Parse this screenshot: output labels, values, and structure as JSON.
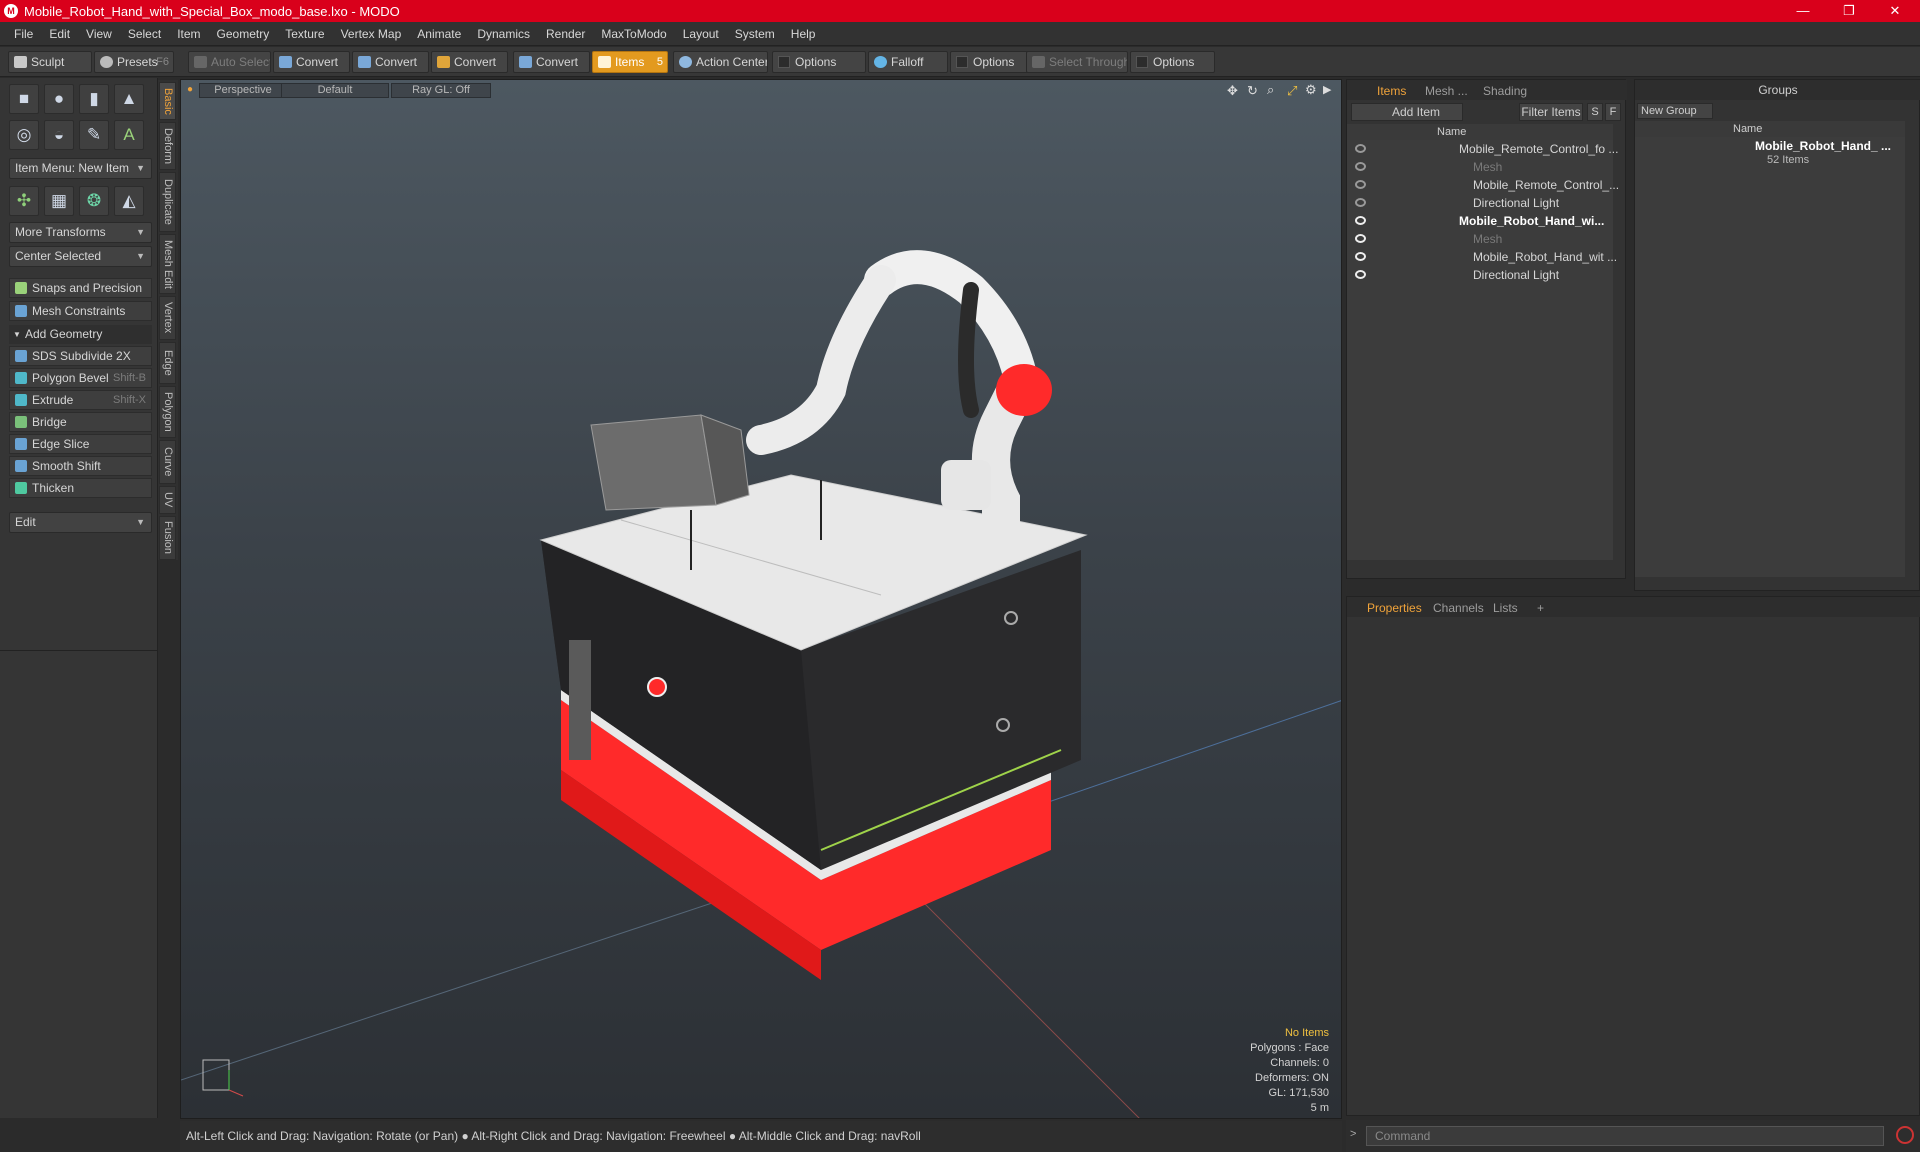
{
  "window": {
    "title": "Mobile_Robot_Hand_with_Special_Box_modo_base.lxo - MODO",
    "minimize_glyph": "—",
    "restore_glyph": "❐",
    "close_glyph": "✕"
  },
  "menu": [
    "File",
    "Edit",
    "View",
    "Select",
    "Item",
    "Geometry",
    "Texture",
    "Vertex Map",
    "Animate",
    "Dynamics",
    "Render",
    "MaxToModo",
    "Layout",
    "System",
    "Help"
  ],
  "toolbar": {
    "sculpt": "Sculpt",
    "presets": "Presets",
    "presets_hotkey": "F6",
    "auto_select": "Auto Select",
    "convert": "Convert",
    "items": "Items",
    "items_count": "5",
    "action_center": "Action Center",
    "options": "Options",
    "falloff": "Falloff",
    "select_through": "Select Through"
  },
  "left_panel": {
    "item_menu": "Item Menu: New Item",
    "more_transforms": "More Transforms",
    "center_selected": "Center Selected",
    "snaps": "Snaps and Precision",
    "mesh_constraints": "Mesh Constraints",
    "add_geometry": "Add Geometry",
    "tools": [
      {
        "label": "SDS Subdivide 2X",
        "shortcut": ""
      },
      {
        "label": "Polygon Bevel",
        "shortcut": "Shift-B"
      },
      {
        "label": "Extrude",
        "shortcut": "Shift-X"
      },
      {
        "label": "Bridge",
        "shortcut": ""
      },
      {
        "label": "Edge Slice",
        "shortcut": ""
      },
      {
        "label": "Smooth Shift",
        "shortcut": ""
      },
      {
        "label": "Thicken",
        "shortcut": ""
      }
    ],
    "edit": "Edit"
  },
  "vertical_tabs": [
    "Basic",
    "Deform",
    "Duplicate",
    "Mesh Edit",
    "Vertex",
    "Edge",
    "Polygon",
    "Curve",
    "UV",
    "Fusion"
  ],
  "viewport": {
    "view": "Perspective",
    "shading": "Default",
    "raygl": "Ray GL: Off",
    "info": {
      "selection": "No Items",
      "polygons": "Polygons : Face",
      "channels": "Channels: 0",
      "deformers": "Deformers: ON",
      "gl": "GL: 171,530",
      "scale": "5 m"
    },
    "colors": {
      "accent_red": "#ff2a2a",
      "body_dark": "#2a2a2c",
      "body_top": "#e8e8e8",
      "trim_green": "#9fd34a"
    }
  },
  "status_bar": "Alt-Left Click and Drag: Navigation: Rotate (or Pan) ● Alt-Right Click and Drag: Navigation: Freewheel ● Alt-Middle Click and Drag: navRoll",
  "items_panel": {
    "tabs": [
      "Items",
      "Mesh ...",
      "Shading"
    ],
    "add_item": "Add Item",
    "filter_items": "Filter Items",
    "s_btn": "S",
    "f_btn": "F",
    "col_name": "Name",
    "rows": [
      {
        "label": "Mobile_Remote_Control_fo ...",
        "bold": false,
        "dim": false
      },
      {
        "label": "Mesh",
        "bold": false,
        "dim": true
      },
      {
        "label": "Mobile_Remote_Control_...",
        "bold": false,
        "dim": false
      },
      {
        "label": "Directional Light",
        "bold": false,
        "dim": false
      },
      {
        "label": "Mobile_Robot_Hand_wi...",
        "bold": true,
        "dim": false
      },
      {
        "label": "Mesh",
        "bold": false,
        "dim": true
      },
      {
        "label": "Mobile_Robot_Hand_wit ...",
        "bold": false,
        "dim": false
      },
      {
        "label": "Directional Light",
        "bold": false,
        "dim": false
      }
    ]
  },
  "groups_panel": {
    "title": "Groups",
    "new_group": "New Group",
    "col_name": "Name",
    "group_name": "Mobile_Robot_Hand_ ...",
    "group_count": "52 Items"
  },
  "properties_panel": {
    "tabs": [
      "Properties",
      "Channels",
      "Lists"
    ],
    "add": "+"
  },
  "command": {
    "placeholder": "Command"
  }
}
